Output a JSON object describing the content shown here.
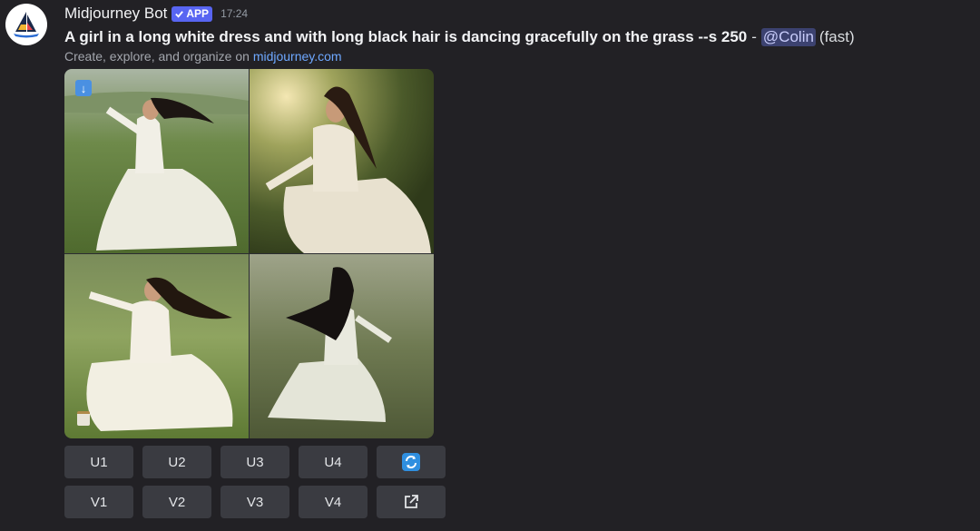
{
  "message": {
    "author": "Midjourney Bot",
    "badge": "APP",
    "timestamp": "17:24",
    "prompt": "A girl in a long white dress and with long black hair is dancing gracefully on the grass --s 250",
    "separator": "-",
    "mention": "@Colin",
    "speed": "(fast)",
    "subtext_prefix": "Create, explore, and organize on ",
    "subtext_link": "midjourney.com"
  },
  "image_grid": {
    "tiles": [
      {
        "description_icon": "girl-dancing-image"
      },
      {
        "description_icon": "girl-dancing-image"
      },
      {
        "description_icon": "girl-dancing-image"
      },
      {
        "description_icon": "girl-dancing-image"
      }
    ],
    "overlay_icons": [
      "download-icon",
      "notes-icon"
    ]
  },
  "buttons": {
    "row1": [
      "U1",
      "U2",
      "U3",
      "U4"
    ],
    "row2": [
      "V1",
      "V2",
      "V3",
      "V4"
    ],
    "reroll_icon": "reroll-icon",
    "open_icon": "open-external-icon"
  },
  "colors": {
    "background": "#222125",
    "badge": "#5865f2",
    "mention_bg": "#3c4270",
    "link": "#6ea8ff",
    "button": "#3a3b41"
  }
}
